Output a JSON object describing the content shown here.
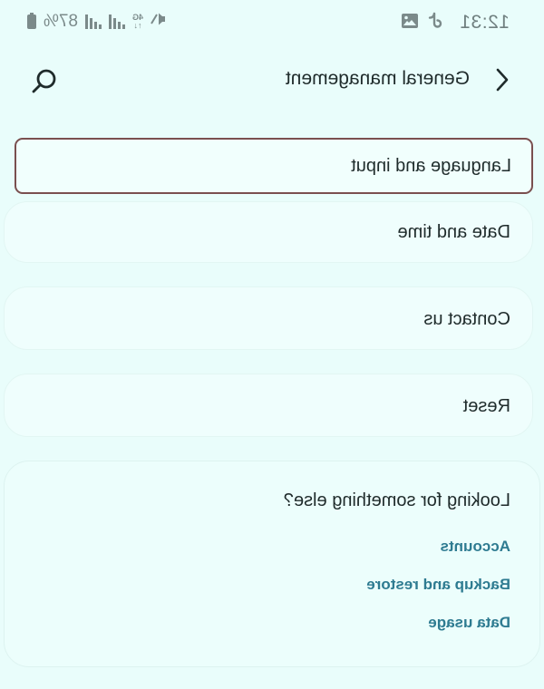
{
  "status_bar": {
    "time": "12:31",
    "battery_percent": "87%",
    "network_type": "4G",
    "icons": [
      "tiktok-icon",
      "image-icon",
      "mute-icon",
      "signal-icon",
      "battery-icon"
    ]
  },
  "header": {
    "title": "General management",
    "back_icon": "chevron-left-icon",
    "search_icon": "search-icon"
  },
  "items": [
    {
      "label": "Language and input",
      "selected": true
    },
    {
      "label": "Date and time",
      "selected": false
    },
    {
      "label": "Contact us",
      "selected": false
    },
    {
      "label": "Reset",
      "selected": false
    }
  ],
  "more": {
    "title": "Looking for something else?",
    "links": [
      "Accounts",
      "Backup and restore",
      "Data usage"
    ]
  },
  "colors": {
    "background": "#e9fdfb",
    "card": "#effefd",
    "link": "#2e7b91",
    "selection_border": "#7a4f4f"
  }
}
